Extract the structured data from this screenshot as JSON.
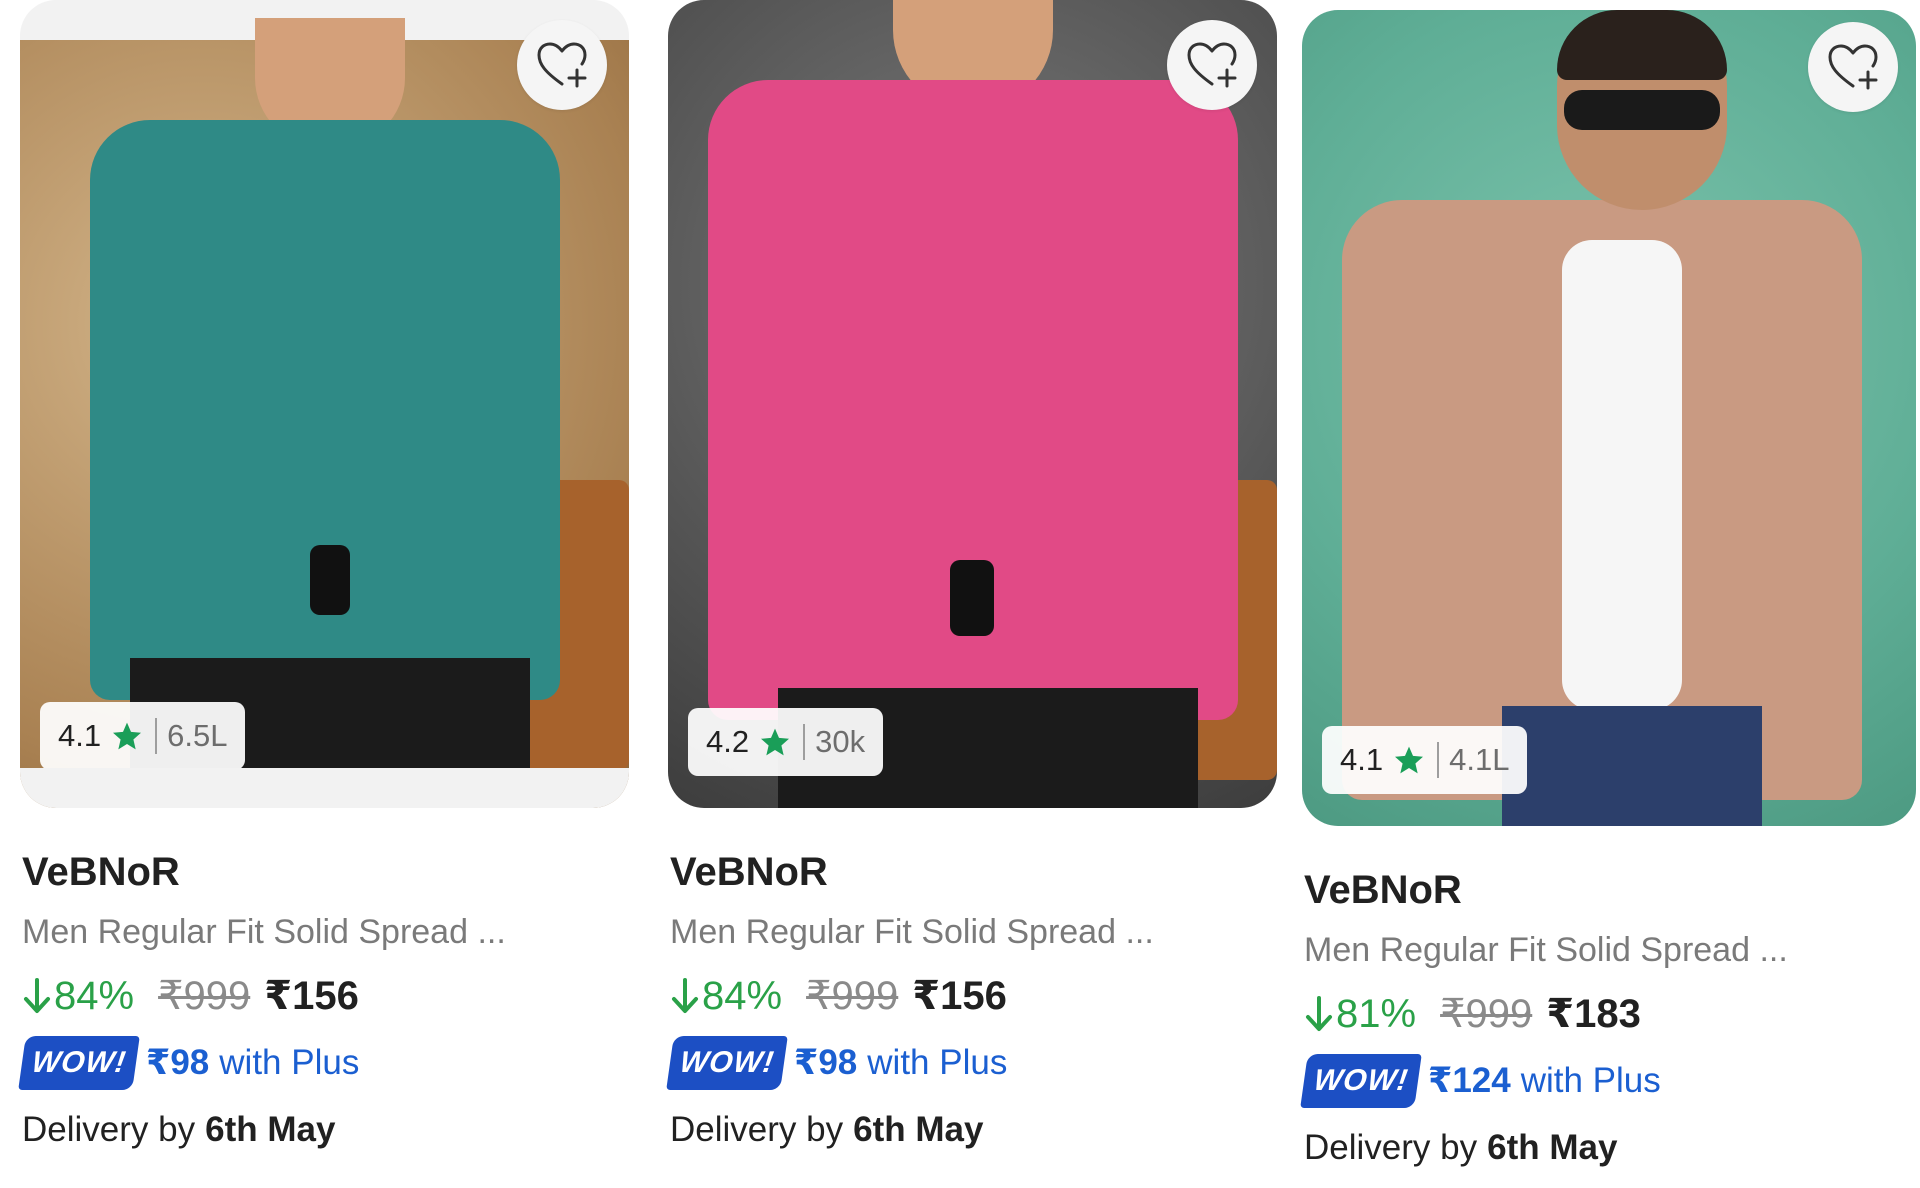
{
  "products": [
    {
      "image_alt": "Teal shirt",
      "favorite_icon": "heart-plus-icon",
      "rating": "4.1",
      "rating_count": "6.5L",
      "brand": "VeBNoR",
      "title": "Men Regular Fit Solid Spread ...",
      "discount": "84%",
      "mrp": "₹999",
      "price": "₹156",
      "wow_label": "WOW!",
      "plus_price": "₹98",
      "plus_text": "with Plus",
      "delivery_label": "Delivery by",
      "delivery_date": "6th May",
      "shirt_color": "#2f8a86"
    },
    {
      "image_alt": "Pink shirt",
      "favorite_icon": "heart-plus-icon",
      "rating": "4.2",
      "rating_count": "30k",
      "brand": "VeBNoR",
      "title": "Men Regular Fit Solid Spread ...",
      "discount": "84%",
      "mrp": "₹999",
      "price": "₹156",
      "wow_label": "WOW!",
      "plus_price": "₹98",
      "plus_text": "with Plus",
      "delivery_label": "Delivery by",
      "delivery_date": "6th May",
      "shirt_color": "#e14a86"
    },
    {
      "image_alt": "Brown check shirt",
      "favorite_icon": "heart-plus-icon",
      "rating": "4.1",
      "rating_count": "4.1L",
      "brand": "VeBNoR",
      "title": "Men Regular Fit Solid Spread ...",
      "discount": "81%",
      "mrp": "₹999",
      "price": "₹183",
      "wow_label": "WOW!",
      "plus_price": "₹124",
      "plus_text": "with Plus",
      "delivery_label": "Delivery by",
      "delivery_date": "6th May",
      "shirt_color": "#c99a82"
    }
  ],
  "colors": {
    "discount_green": "#2aa148",
    "star_green": "#1a9e58",
    "plus_blue": "#1b5fd1",
    "wow_blue": "#1c4fc4"
  }
}
